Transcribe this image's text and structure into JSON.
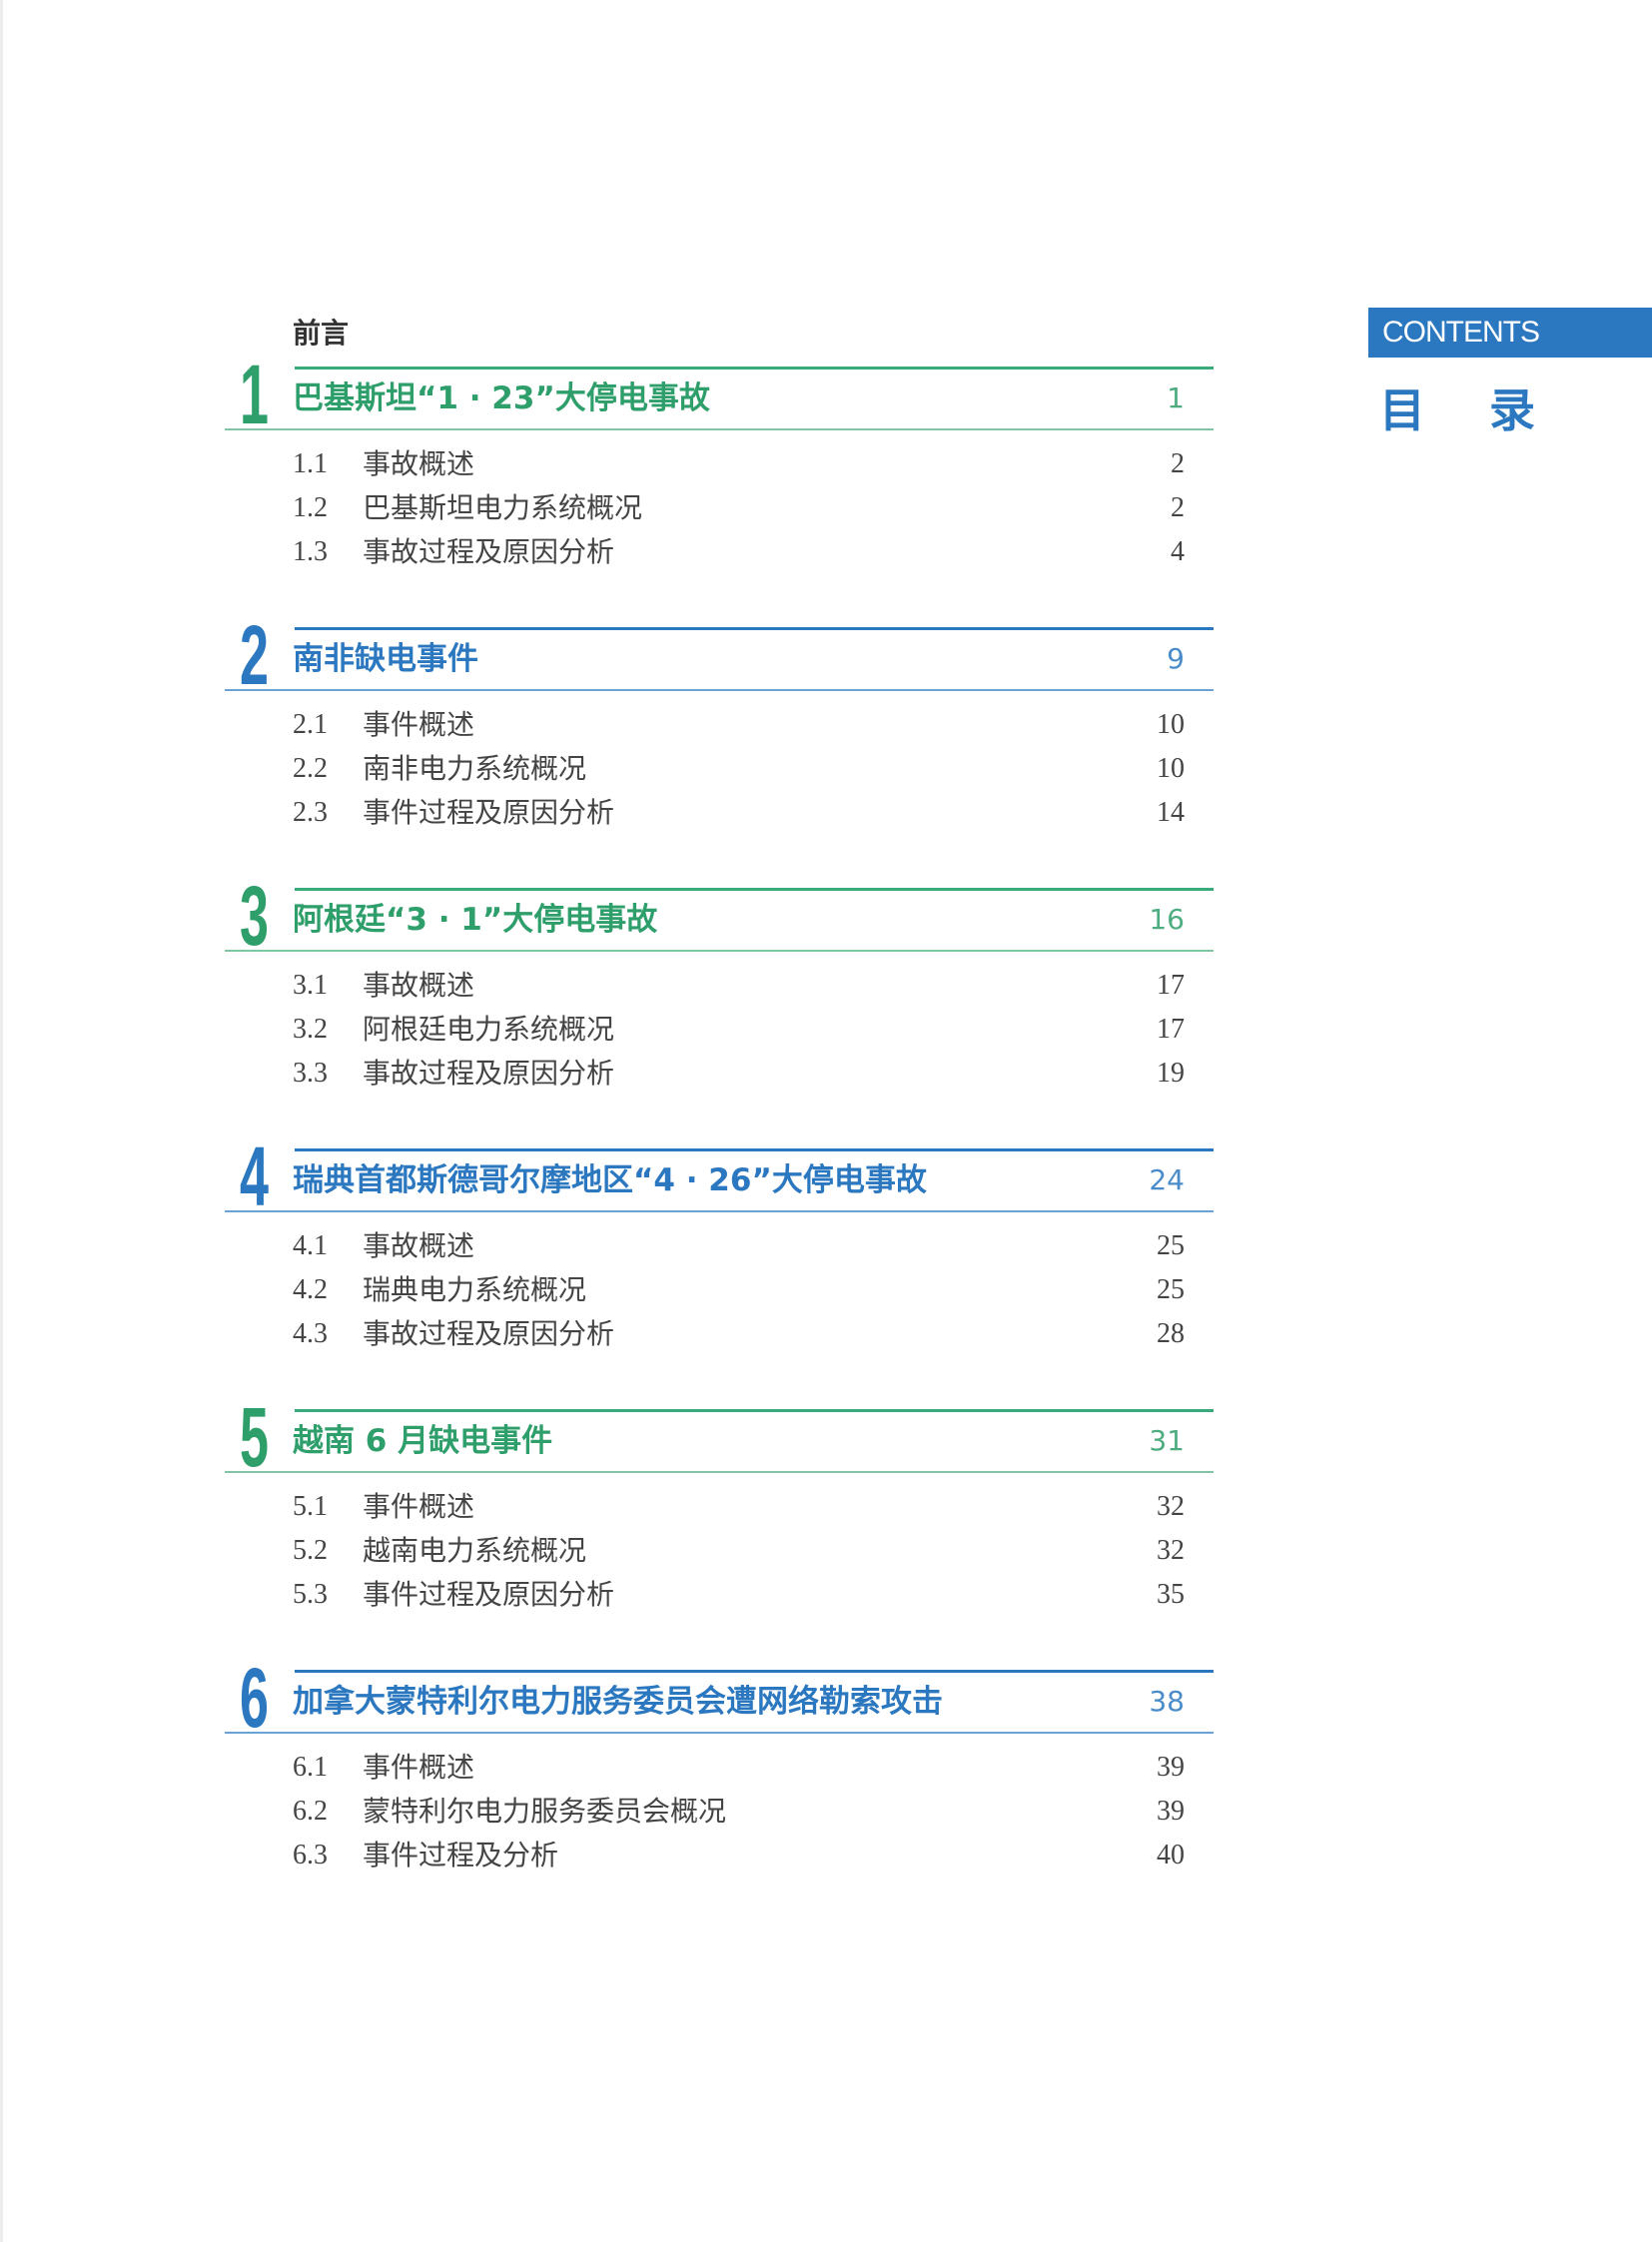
{
  "sidebar": {
    "contents_label": "CONTENTS",
    "title": "目 录"
  },
  "preface": "前言",
  "chapters": [
    {
      "number": "1",
      "title": "巴基斯坦“1 · 23”大停电事故",
      "page": "1",
      "accent": "green",
      "items": [
        {
          "num": "1.1",
          "label": "事故概述",
          "page": "2"
        },
        {
          "num": "1.2",
          "label": "巴基斯坦电力系统概况",
          "page": "2"
        },
        {
          "num": "1.3",
          "label": "事故过程及原因分析",
          "page": "4"
        }
      ]
    },
    {
      "number": "2",
      "title": "南非缺电事件",
      "page": "9",
      "accent": "blue",
      "items": [
        {
          "num": "2.1",
          "label": "事件概述",
          "page": "10"
        },
        {
          "num": "2.2",
          "label": "南非电力系统概况",
          "page": "10"
        },
        {
          "num": "2.3",
          "label": "事件过程及原因分析",
          "page": "14"
        }
      ]
    },
    {
      "number": "3",
      "title": "阿根廷“3 · 1”大停电事故",
      "page": "16",
      "accent": "green",
      "items": [
        {
          "num": "3.1",
          "label": "事故概述",
          "page": "17"
        },
        {
          "num": "3.2",
          "label": "阿根廷电力系统概况",
          "page": "17"
        },
        {
          "num": "3.3",
          "label": "事故过程及原因分析",
          "page": "19"
        }
      ]
    },
    {
      "number": "4",
      "title": "瑞典首都斯德哥尔摩地区“4 · 26”大停电事故",
      "page": "24",
      "accent": "blue",
      "items": [
        {
          "num": "4.1",
          "label": "事故概述",
          "page": "25"
        },
        {
          "num": "4.2",
          "label": "瑞典电力系统概况",
          "page": "25"
        },
        {
          "num": "4.3",
          "label": "事故过程及原因分析",
          "page": "28"
        }
      ]
    },
    {
      "number": "5",
      "title": "越南 6 月缺电事件",
      "page": "31",
      "accent": "green",
      "items": [
        {
          "num": "5.1",
          "label": "事件概述",
          "page": "32"
        },
        {
          "num": "5.2",
          "label": "越南电力系统概况",
          "page": "32"
        },
        {
          "num": "5.3",
          "label": "事件过程及原因分析",
          "page": "35"
        }
      ]
    },
    {
      "number": "6",
      "title": "加拿大蒙特利尔电力服务委员会遭网络勒索攻击",
      "page": "38",
      "accent": "blue",
      "items": [
        {
          "num": "6.1",
          "label": "事件概述",
          "page": "39"
        },
        {
          "num": "6.2",
          "label": "蒙特利尔电力服务委员会概况",
          "page": "39"
        },
        {
          "num": "6.3",
          "label": "事件过程及分析",
          "page": "40"
        }
      ]
    }
  ]
}
